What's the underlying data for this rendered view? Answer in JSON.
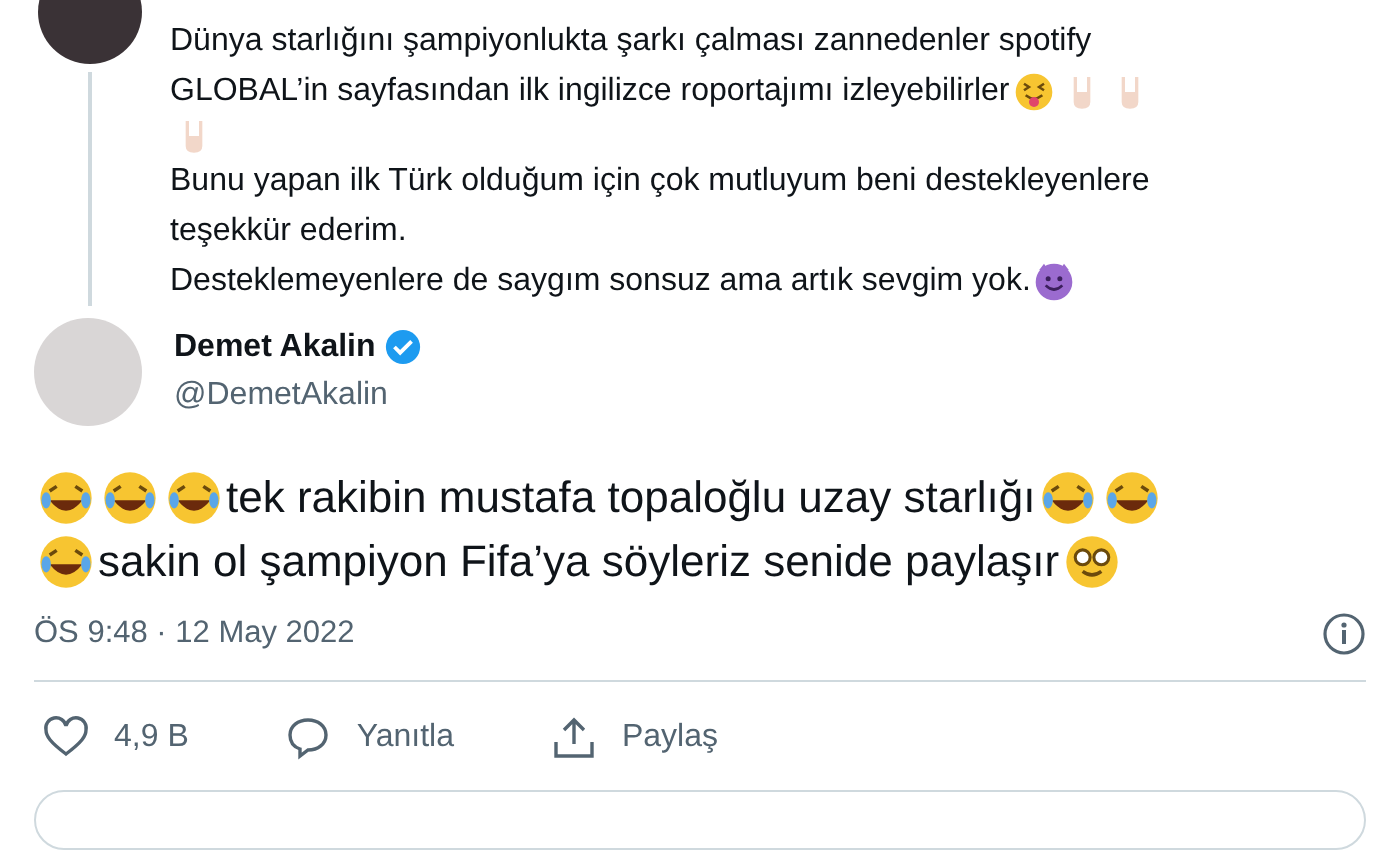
{
  "quoted_tweet": {
    "lines": [
      [
        {
          "kind": "text",
          "text": "Dünya starlığını şampiyonlukta şarkı çalması zannedenler spotify"
        }
      ],
      [
        {
          "kind": "text",
          "text": "GLOBAL’in  sayfasından ilk ingilizce roportajımı izleyebilirler"
        },
        {
          "kind": "tongue"
        },
        {
          "kind": "horns"
        },
        {
          "kind": "horns"
        }
      ],
      [
        {
          "kind": "horns"
        }
      ],
      [
        {
          "kind": "text",
          "text": "Bunu yapan ilk Türk olduğum için çok mutluyum beni destekleyenlere"
        }
      ],
      [
        {
          "kind": "text",
          "text": "teşekkür ederim."
        }
      ],
      [
        {
          "kind": "text",
          "text": "Desteklemeyenlere de saygım sonsuz ama artık sevgim yok."
        },
        {
          "kind": "devil"
        }
      ]
    ]
  },
  "tweet": {
    "author": {
      "name": "Demet Akalin",
      "handle": "@DemetAkalin",
      "verified": true
    },
    "lines": [
      [
        {
          "kind": "laughing"
        },
        {
          "kind": "laughing"
        },
        {
          "kind": "laughing"
        },
        {
          "kind": "text",
          "text": "tek rakibin mustafa topaloğlu uzay starlığı"
        },
        {
          "kind": "laughing"
        },
        {
          "kind": "laughing"
        }
      ],
      [
        {
          "kind": "laughing"
        },
        {
          "kind": "text",
          "text": "sakin ol şampiyon Fifa’ya söyleriz senide paylaşır"
        },
        {
          "kind": "nerd"
        }
      ]
    ],
    "timestamp": "ÖS 9:48 · 12 May 2022",
    "actions": [
      {
        "kind": "like",
        "label": "4,9 B"
      },
      {
        "kind": "reply",
        "label": "Yanıtla"
      },
      {
        "kind": "share",
        "label": "Paylaş"
      }
    ]
  }
}
